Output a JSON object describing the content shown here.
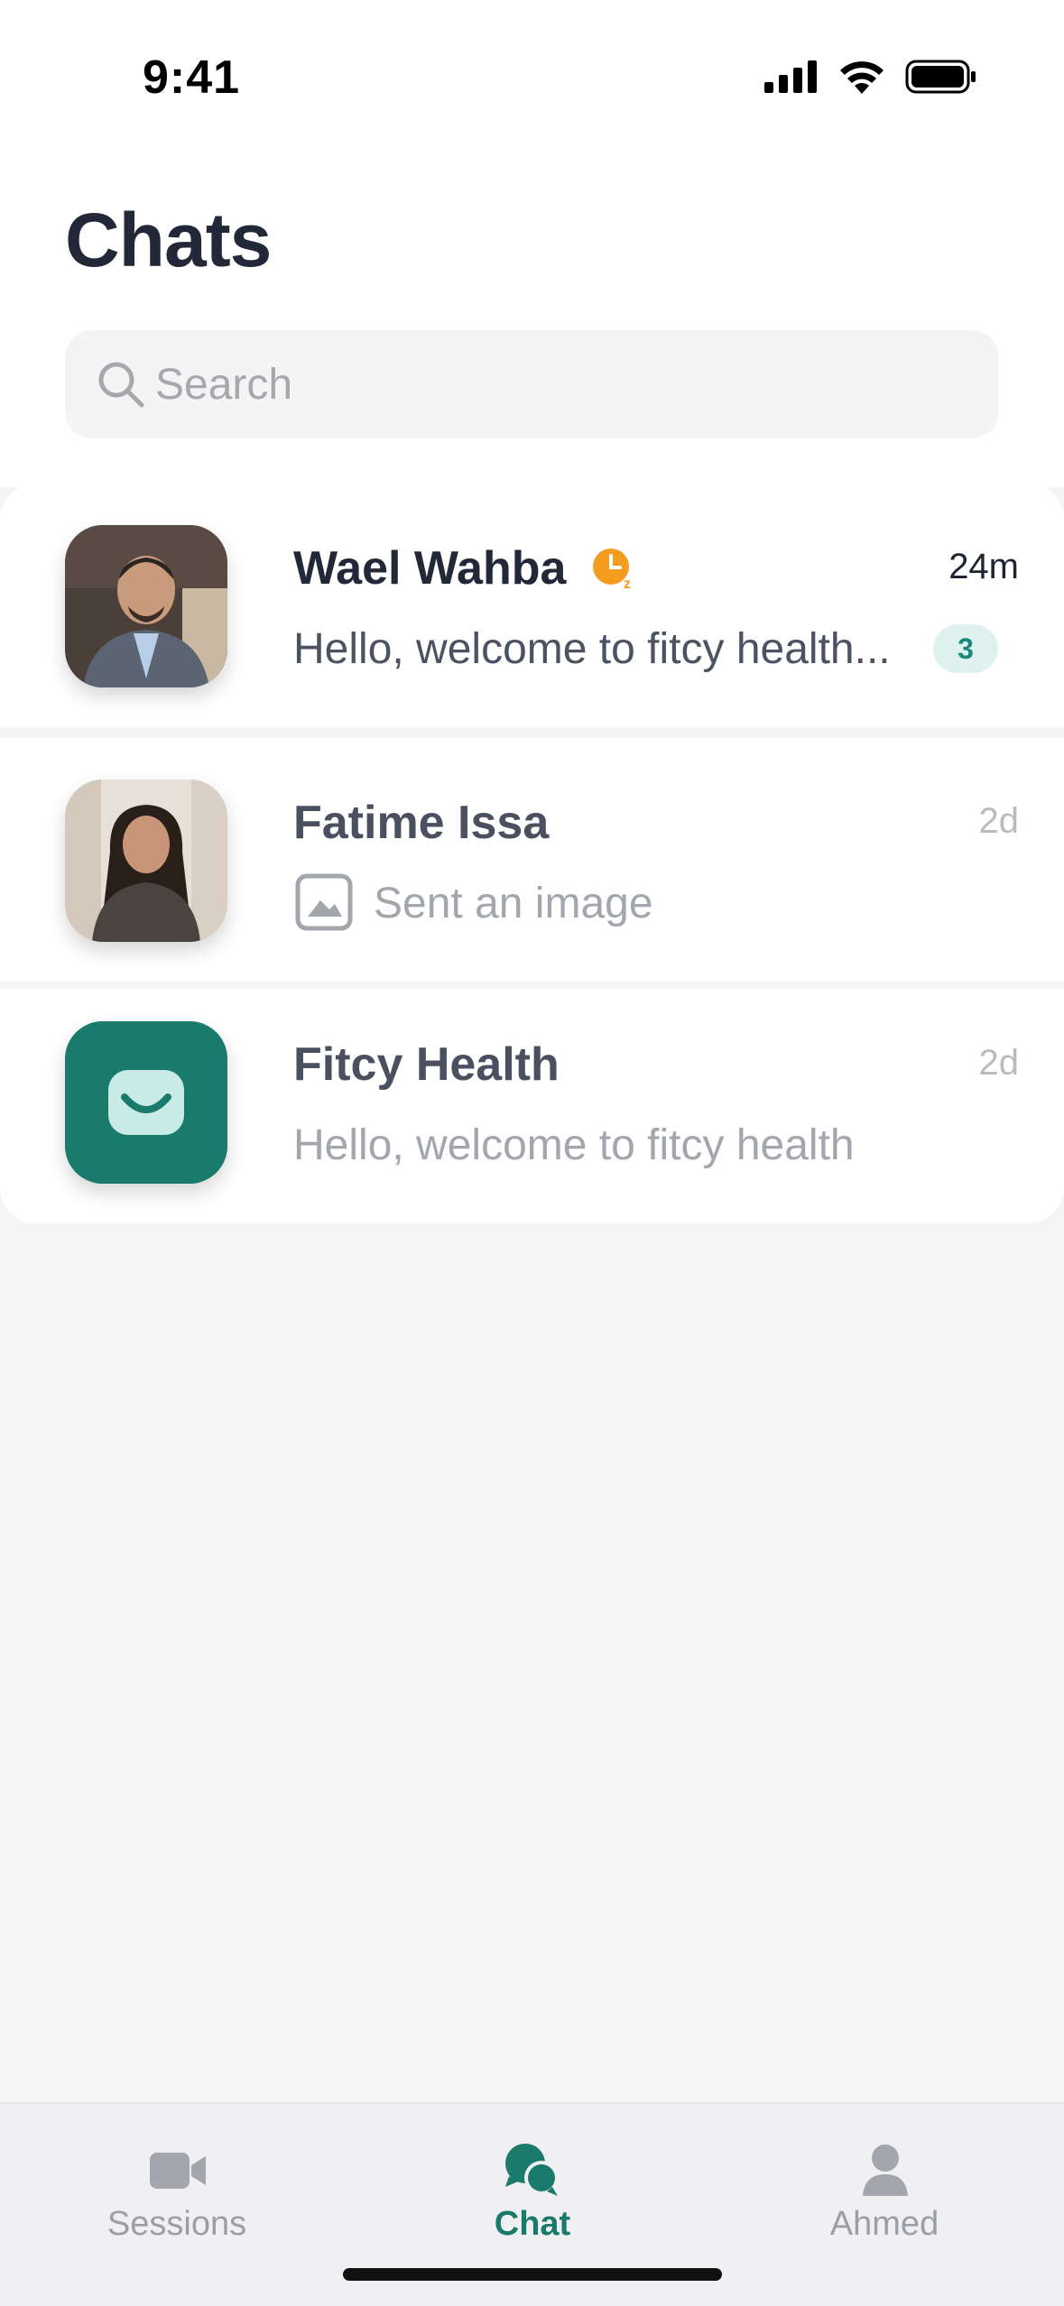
{
  "status_bar": {
    "time": "9:41"
  },
  "header": {
    "title": "Chats"
  },
  "search": {
    "placeholder": "Search",
    "value": ""
  },
  "chats": [
    {
      "name": "Wael Wahba",
      "time": "24m",
      "preview": "Hello, welcome to fitcy health...",
      "unread": "3",
      "status_icon": "clock-snooze-icon"
    },
    {
      "name": "Fatime Issa",
      "time": "2d",
      "preview": "Sent an image",
      "preview_icon": "image-icon"
    },
    {
      "name": "Fitcy Health",
      "time": "2d",
      "preview": "Hello, welcome to fitcy health",
      "avatar_icon": "fitcy-logo-icon"
    }
  ],
  "tab_bar": {
    "tabs": [
      {
        "label": "Sessions",
        "icon": "video-camera-icon",
        "active": false
      },
      {
        "label": "Chat",
        "icon": "chat-bubbles-icon",
        "active": true
      },
      {
        "label": "Ahmed",
        "icon": "user-icon",
        "active": false
      }
    ]
  },
  "colors": {
    "brand": "#1a7b6c",
    "badge_bg": "#dff2ef",
    "status_orange": "#f39c1f",
    "text_dark": "#232838",
    "text_muted": "#a3a6ad"
  }
}
